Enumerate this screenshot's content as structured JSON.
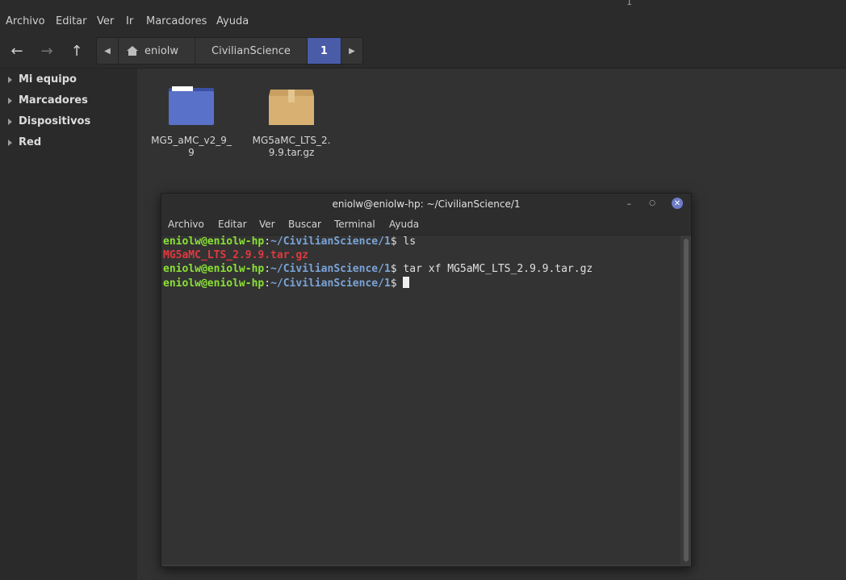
{
  "window": {
    "title_fragment": "1"
  },
  "menubar": {
    "items": [
      "Archivo",
      "Editar",
      "Ver",
      "Ir",
      "Marcadores",
      "Ayuda"
    ]
  },
  "toolbar": {
    "back_icon": "arrow-left-icon",
    "forward_icon": "arrow-right-icon",
    "up_icon": "arrow-up-icon",
    "breadcrumbs": [
      "eniolw",
      "CivilianScience",
      "1"
    ]
  },
  "sidebar": {
    "items": [
      "Mi equipo",
      "Marcadores",
      "Dispositivos",
      "Red"
    ]
  },
  "files": [
    {
      "name": "MG5_aMC_v2_9_9",
      "icon": "folder-icon"
    },
    {
      "name": "MG5aMC_LTS_2.9.9.tar.gz",
      "icon": "archive-icon"
    }
  ],
  "terminal": {
    "title": "eniolw@eniolw-hp: ~/CivilianScience/1",
    "menu": [
      "Archivo",
      "Editar",
      "Ver",
      "Buscar",
      "Terminal",
      "Ayuda"
    ],
    "user_host": "eniolw@eniolw-hp",
    "path": "~/CivilianScience/1",
    "prompt_sep": ":",
    "prompt_end": "$",
    "cmd1": " ls",
    "ls_output": "MG5aMC_LTS_2.9.9.tar.gz",
    "cmd2": " tar xf MG5aMC_LTS_2.9.9.tar.gz",
    "cmd3": " ",
    "colors": {
      "user": "#8ae234",
      "path": "#7aa4d9",
      "archive": "#e0393e"
    }
  }
}
